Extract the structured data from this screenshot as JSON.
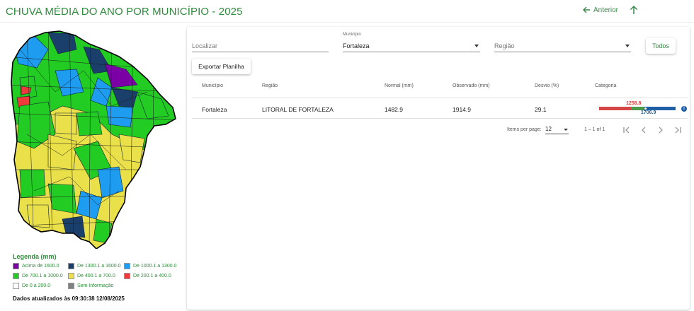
{
  "header": {
    "title": "CHUVA MÉDIA DO ANO POR MUNICÍPIO - 2025",
    "back_label": "Anterior",
    "back_icon": "arrow-left-icon",
    "up_icon": "arrow-up-icon",
    "accent": "#2e8b3b"
  },
  "map": {
    "legend_title": "Legenda (mm)",
    "legend": [
      {
        "label": "Acima de 1600.0",
        "color": "#7b00a6"
      },
      {
        "label": "De 1300.1 a 1600.0",
        "color": "#1b3f6b"
      },
      {
        "label": "De 1000.1 a 1300.0",
        "color": "#1e9cf0"
      },
      {
        "label": "De 700.1 a 1000.0",
        "color": "#22cc22"
      },
      {
        "label": "De 400.1 a 700.0",
        "color": "#eae04a"
      },
      {
        "label": "De 200.1 a 400.0",
        "color": "#ee3a3a"
      },
      {
        "label": "De 0 a 200.0",
        "color": "#ffffff"
      },
      {
        "label": "Sem Informação",
        "color": "#808080"
      }
    ],
    "updated": "Dados atualizados às 09:30:38 12/08/2025"
  },
  "filters": {
    "search_placeholder": "Localizar",
    "municipio_label": "Município",
    "municipio_value": "Fortaleza",
    "regiao_placeholder": "Região",
    "todos_label": "Todos",
    "export_label": "Exportar Planilha"
  },
  "table": {
    "columns": [
      "Município",
      "Região",
      "Normal (mm)",
      "Observado (mm)",
      "Desvio (%)",
      "Categoria"
    ],
    "rows": [
      {
        "municipio": "Fortaleza",
        "regiao": "LITORAL DE FORTALEZA",
        "normal": "1482.9",
        "observado": "1914.9",
        "desvio": "29.1",
        "categoria": {
          "label_a": "1258.8",
          "label_b": "1706.9",
          "colors": [
            "#d64545",
            "#4a9a4a",
            "#1f5fa5"
          ]
        }
      }
    ]
  },
  "paginator": {
    "items_label": "Items per page:",
    "page_size": "12",
    "range": "1 – 1 of 1",
    "icons": [
      "first-page-icon",
      "previous-page-icon",
      "next-page-icon",
      "last-page-icon"
    ]
  }
}
